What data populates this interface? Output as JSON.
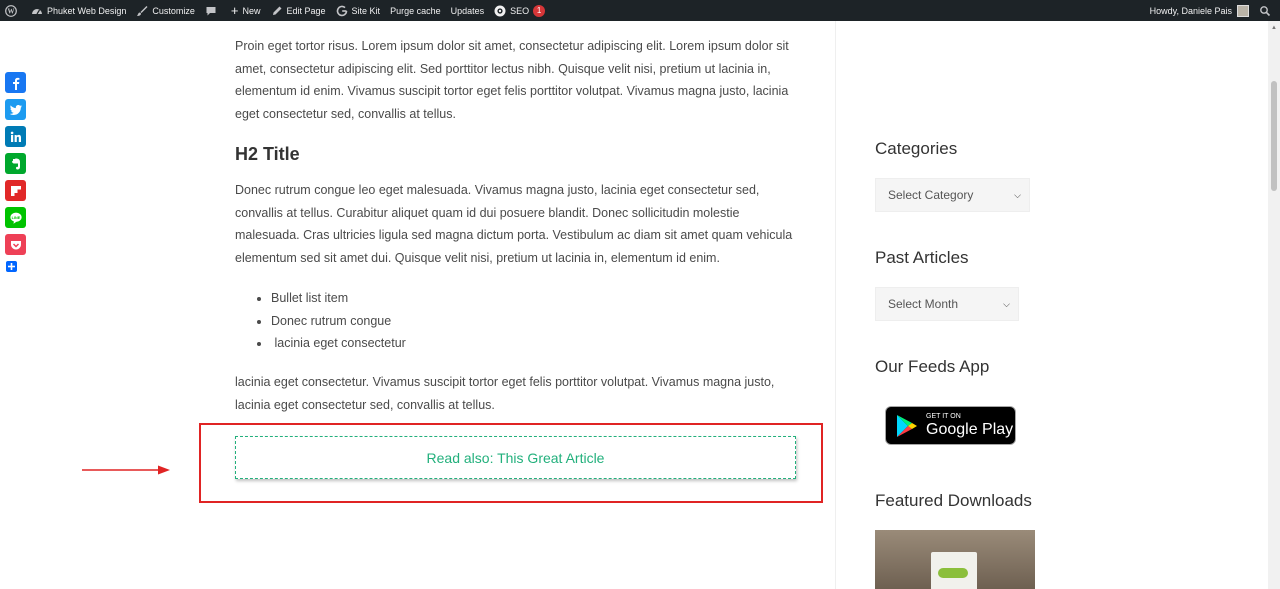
{
  "admin_bar": {
    "site_name": "Phuket Web Design",
    "customize": "Customize",
    "new": "New",
    "edit_page": "Edit Page",
    "site_kit": "Site Kit",
    "purge_cache": "Purge cache",
    "updates": "Updates",
    "seo": "SEO",
    "seo_count": "1",
    "howdy": "Howdy, Daniele Pais"
  },
  "share": {
    "icons": [
      "facebook-icon",
      "twitter-icon",
      "linkedin-icon",
      "evernote-icon",
      "flipboard-icon",
      "line-icon",
      "pocket-icon",
      "add-to-any-icon"
    ],
    "colors": {
      "facebook": "#1877f2",
      "twitter": "#1d9bf0",
      "linkedin": "#007bb5",
      "evernote": "#00a82d",
      "flipboard": "#e12828",
      "line": "#00c300",
      "pocket": "#ee4056",
      "add": "#0166ff"
    }
  },
  "article": {
    "paragraph_1": "Proin eget tortor risus. Lorem ipsum dolor sit amet, consectetur adipiscing elit. Lorem ipsum dolor sit amet, consectetur adipiscing elit. Sed porttitor lectus nibh. Quisque velit nisi, pretium ut lacinia in, elementum id enim. Vivamus suscipit tortor eget felis porttitor volutpat. Vivamus magna justo, lacinia eget consectetur sed, convallis at tellus.",
    "h2_title": "H2 Title",
    "paragraph_2": "Donec rutrum congue leo eget malesuada. Vivamus magna justo, lacinia eget consectetur sed, convallis at tellus. Curabitur aliquet quam id dui posuere blandit. Donec sollicitudin molestie malesuada. Cras ultricies ligula sed magna dictum porta. Vestibulum ac diam sit amet quam vehicula elementum sed sit amet dui. Quisque velit nisi, pretium ut lacinia in, elementum id enim.",
    "bullets": [
      "Bullet list item",
      "Donec rutrum congue",
      " lacinia eget consectetur"
    ],
    "paragraph_3": "lacinia eget consectetur. Vivamus suscipit tortor eget felis porttitor volutpat. Vivamus magna justo, lacinia eget consectetur sed, convallis at tellus.",
    "read_also": "Read also: This Great Article",
    "accent_color": "#22b07c",
    "highlight_color": "#e02424"
  },
  "sidebar": {
    "categories_title": "Categories",
    "categories_select": "Select Category",
    "past_articles_title": "Past Articles",
    "past_articles_select": "Select Month",
    "feeds_title": "Our Feeds App",
    "google_play_small": "GET IT ON",
    "google_play_big": "Google Play",
    "featured_title": "Featured Downloads"
  }
}
